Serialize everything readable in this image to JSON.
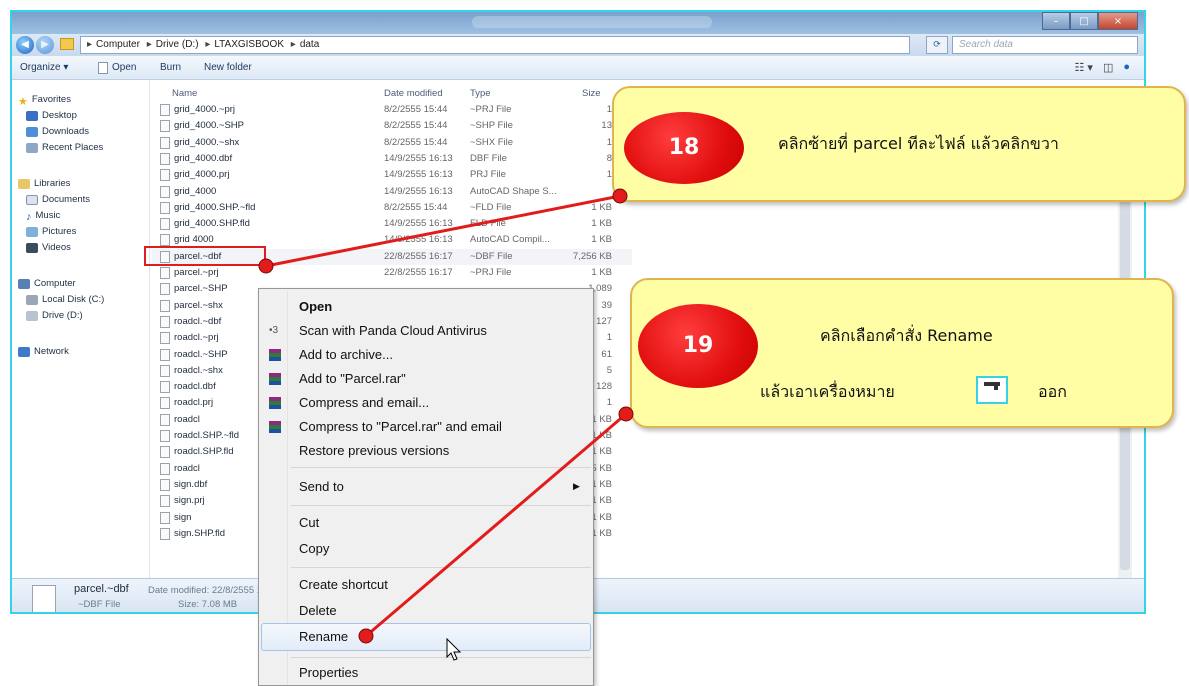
{
  "window": {
    "address": [
      "Computer",
      "Drive (D:)",
      "LTAXGISBOOK",
      "data"
    ],
    "search_placeholder": "Search data",
    "window_controls": [
      "minimize-icon",
      "maximize-icon",
      "close-icon"
    ]
  },
  "toolbar": {
    "organize": "Organize ▾",
    "open": "Open",
    "burn": "Burn",
    "new_folder": "New folder"
  },
  "nav": {
    "favorites": "Favorites",
    "desktop": "Desktop",
    "downloads": "Downloads",
    "recent": "Recent Places",
    "libraries": "Libraries",
    "documents": "Documents",
    "music": "Music",
    "pictures": "Pictures",
    "videos": "Videos",
    "computer": "Computer",
    "local_disk": "Local Disk (C:)",
    "drive_d": "Drive (D:)",
    "network": "Network"
  },
  "columns": {
    "name": "Name",
    "date": "Date modified",
    "type": "Type",
    "size": "Size"
  },
  "files": [
    {
      "name": "grid_4000.~prj",
      "date": "8/2/2555 15:44",
      "type": "~PRJ File",
      "size": "1"
    },
    {
      "name": "grid_4000.~SHP",
      "date": "8/2/2555 15:44",
      "type": "~SHP File",
      "size": "13"
    },
    {
      "name": "grid_4000.~shx",
      "date": "8/2/2555 15:44",
      "type": "~SHX File",
      "size": "1"
    },
    {
      "name": "grid_4000.dbf",
      "date": "14/9/2555 16:13",
      "type": "DBF File",
      "size": "8"
    },
    {
      "name": "grid_4000.prj",
      "date": "14/9/2555 16:13",
      "type": "PRJ File",
      "size": "1"
    },
    {
      "name": "grid_4000",
      "date": "14/9/2555 16:13",
      "type": "AutoCAD Shape S...",
      "size": ""
    },
    {
      "name": "grid_4000.SHP.~fld",
      "date": "8/2/2555 15:44",
      "type": "~FLD File",
      "size": "1 KB"
    },
    {
      "name": "grid_4000.SHP.fld",
      "date": "14/9/2555 16:13",
      "type": "FLD File",
      "size": "1 KB"
    },
    {
      "name": "grid 4000",
      "date": "14/9/2555 16:13",
      "type": "AutoCAD Compil...",
      "size": "1 KB"
    },
    {
      "name": "parcel.~dbf",
      "date": "22/8/2555 16:17",
      "type": "~DBF File",
      "size": "7,256 KB"
    },
    {
      "name": "parcel.~prj",
      "date": "22/8/2555 16:17",
      "type": "~PRJ File",
      "size": "1 KB"
    },
    {
      "name": "parcel.~SHP",
      "date": "",
      "type": "",
      "size": "1,089"
    },
    {
      "name": "parcel.~shx",
      "date": "",
      "type": "",
      "size": "39"
    },
    {
      "name": "roadcl.~dbf",
      "date": "",
      "type": "",
      "size": "127"
    },
    {
      "name": "roadcl.~prj",
      "date": "",
      "type": "",
      "size": "1"
    },
    {
      "name": "roadcl.~SHP",
      "date": "",
      "type": "",
      "size": "61"
    },
    {
      "name": "roadcl.~shx",
      "date": "",
      "type": "",
      "size": "5"
    },
    {
      "name": "roadcl.dbf",
      "date": "",
      "type": "",
      "size": "128"
    },
    {
      "name": "roadcl.prj",
      "date": "",
      "type": "",
      "size": "1"
    },
    {
      "name": "roadcl",
      "date": "",
      "type": "",
      "size": "61 KB"
    },
    {
      "name": "roadcl.SHP.~fld",
      "date": "",
      "type": "",
      "size": "1 KB"
    },
    {
      "name": "roadcl.SHP.fld",
      "date": "",
      "type": "",
      "size": "1 KB"
    },
    {
      "name": "roadcl",
      "date": "",
      "type": "",
      "size": "5 KB"
    },
    {
      "name": "sign.dbf",
      "date": "",
      "type": "",
      "size": "1 KB"
    },
    {
      "name": "sign.prj",
      "date": "",
      "type": "",
      "size": "1 KB"
    },
    {
      "name": "sign",
      "date": "",
      "type": "",
      "size": "1 KB"
    },
    {
      "name": "sign.SHP.fld",
      "date": "",
      "type": "",
      "size": "1 KB"
    }
  ],
  "details": {
    "filename": "parcel.~dbf",
    "date_label": "Date modified: 22/8/2555 16",
    "type": "~DBF File",
    "size_label": "Size: 7.08 MB"
  },
  "context_menu": {
    "open": "Open",
    "scan": "Scan with Panda Cloud Antivirus",
    "add_archive": "Add to archive...",
    "add_rar": "Add to \"Parcel.rar\"",
    "compress_email": "Compress and email...",
    "compress_rar_email": "Compress to \"Parcel.rar\" and email",
    "restore": "Restore previous versions",
    "send_to": "Send to",
    "cut": "Cut",
    "copy": "Copy",
    "create_shortcut": "Create shortcut",
    "delete": "Delete",
    "rename": "Rename",
    "properties": "Properties"
  },
  "callout18": {
    "number": "18",
    "text": "คลิกซ้ายที่ parcel ทีละไฟล์ แล้วคลิกขวา"
  },
  "callout19": {
    "number": "19",
    "line1": "คลิกเลือกคำสั่ง    Rename",
    "line2_before": "แล้วเอาเครื่องหมาย",
    "line2_after": "ออก"
  },
  "colors": {
    "accent_red": "#e21b1b",
    "callout_fill": "#fffea4",
    "callout_border": "#e0b44e",
    "window_border": "#34d4e8"
  }
}
